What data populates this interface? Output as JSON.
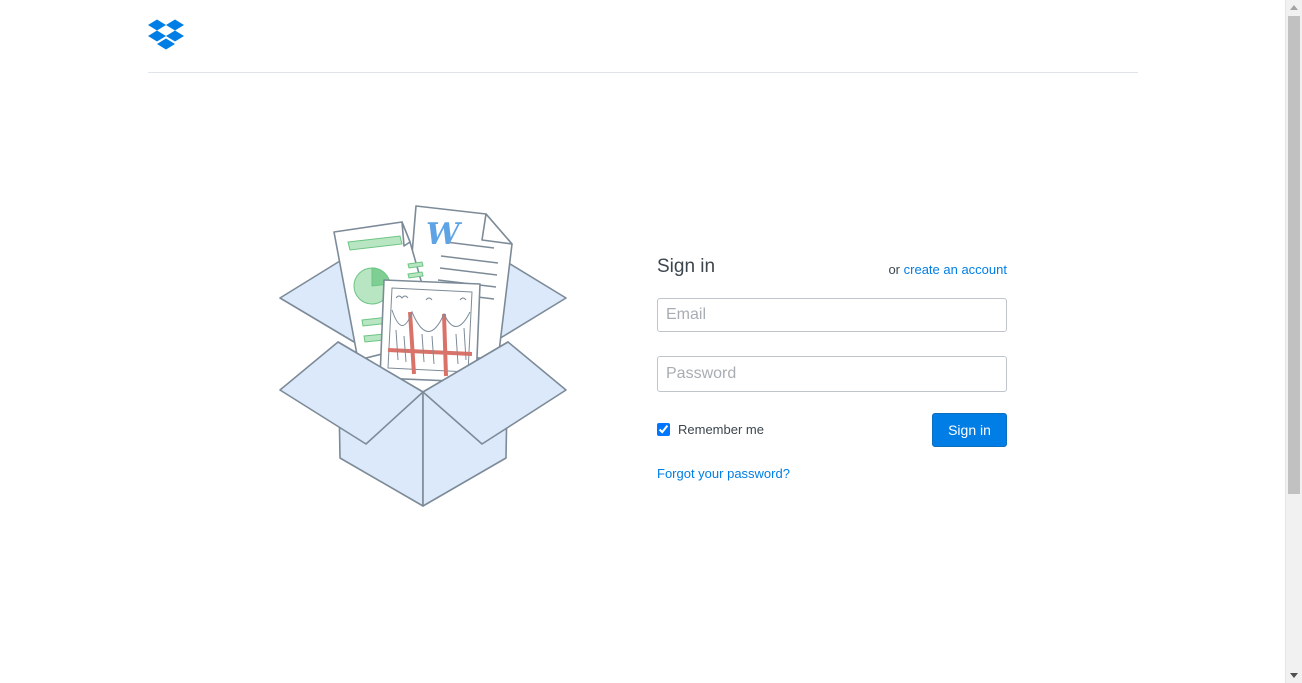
{
  "brand": {
    "logo_icon": "dropbox-logo-icon",
    "accent_color": "#007ee5"
  },
  "illustration": {
    "icon": "open-box-with-documents-illustration",
    "doc_letter": "W"
  },
  "signin": {
    "title": "Sign in",
    "alt_prefix": "or",
    "create_account_label": "create an account",
    "email_placeholder": "Email",
    "email_value": "",
    "password_placeholder": "Password",
    "password_value": "",
    "remember_label": "Remember me",
    "remember_checked": true,
    "submit_label": "Sign in",
    "forgot_label": "Forgot your password?"
  }
}
